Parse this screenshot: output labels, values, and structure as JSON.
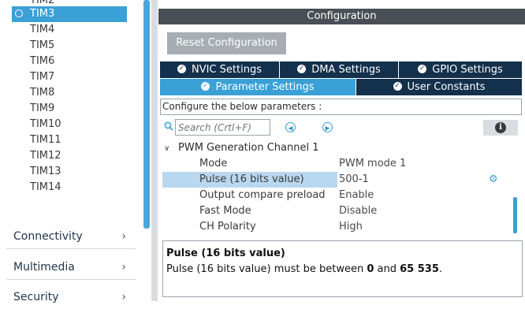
{
  "tree": {
    "partial_top": "TIM2",
    "selected": "TIM3",
    "items": [
      "TIM4",
      "TIM5",
      "TIM6",
      "TIM7",
      "TIM8",
      "TIM9",
      "TIM10",
      "TIM11",
      "TIM12",
      "TIM13",
      "TIM14"
    ]
  },
  "categories": [
    {
      "label": "Connectivity",
      "chevron": "›"
    },
    {
      "label": "Multimedia",
      "chevron": "›"
    },
    {
      "label": "Security",
      "chevron": "›"
    }
  ],
  "config": {
    "title": "Configuration",
    "reset_label": "Reset Configuration",
    "tabs_row1": [
      {
        "label": "NVIC Settings",
        "icon": "check-circle-icon"
      },
      {
        "label": "DMA Settings",
        "icon": "check-circle-icon"
      },
      {
        "label": "GPIO Settings",
        "icon": "check-circle-icon"
      }
    ],
    "tabs_row2": [
      {
        "label": "Parameter Settings",
        "icon": "check-circle-icon"
      },
      {
        "label": "User Constants",
        "icon": "check-circle-icon"
      }
    ],
    "hint": "Configure the below parameters :",
    "search_placeholder": "Search (Crtl+F)"
  },
  "group": {
    "title": "PWM Generation Channel 1",
    "params": [
      {
        "name": "Mode",
        "value": "PWM mode 1"
      },
      {
        "name": "Pulse (16 bits value)",
        "value": "500-1"
      },
      {
        "name": "Output compare preload",
        "value": "Enable"
      },
      {
        "name": "Fast Mode",
        "value": "Disable"
      },
      {
        "name": "CH Polarity",
        "value": "High"
      }
    ]
  },
  "description": {
    "title": "Pulse (16 bits value)",
    "text_prefix": "Pulse (16 bits value) must be between ",
    "min": "0",
    "mid": " and ",
    "max": "65 535",
    "suffix": "."
  },
  "colors": {
    "accent": "#3aa0d6",
    "tab_dark": "#13304c",
    "header": "#4a4f55"
  }
}
